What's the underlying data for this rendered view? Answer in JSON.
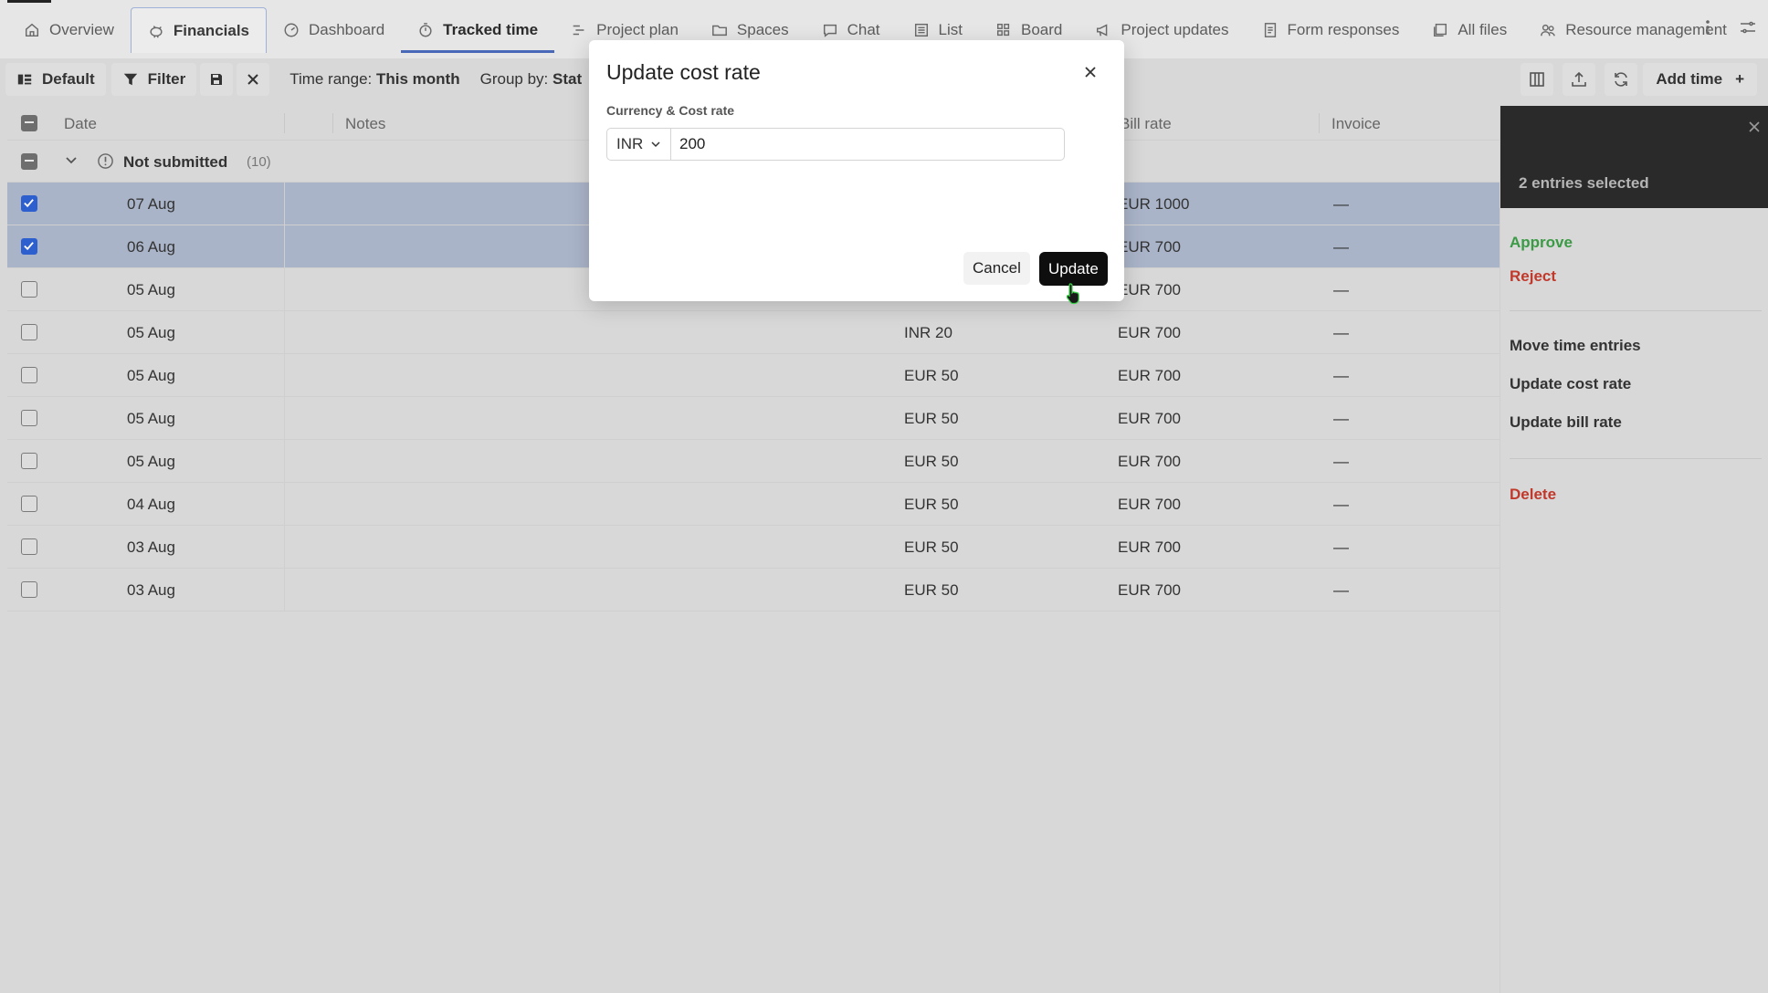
{
  "tabs": [
    {
      "label": "Overview",
      "icon": "home-icon"
    },
    {
      "label": "Financials",
      "icon": "piggy-bank-icon"
    },
    {
      "label": "Dashboard",
      "icon": "gauge-icon"
    },
    {
      "label": "Tracked time",
      "icon": "stopwatch-icon"
    },
    {
      "label": "Project plan",
      "icon": "gantt-icon"
    },
    {
      "label": "Spaces",
      "icon": "folder-icon"
    },
    {
      "label": "Chat",
      "icon": "chat-icon"
    },
    {
      "label": "List",
      "icon": "list-icon"
    },
    {
      "label": "Board",
      "icon": "board-icon"
    },
    {
      "label": "Project updates",
      "icon": "megaphone-icon"
    },
    {
      "label": "Form responses",
      "icon": "form-icon"
    },
    {
      "label": "All files",
      "icon": "files-icon"
    },
    {
      "label": "Resource management",
      "icon": "people-icon"
    }
  ],
  "toolbar": {
    "view_label": "Default",
    "filter_label": "Filter",
    "time_range_label": "Time range:",
    "time_range_value": "This month",
    "group_by_label": "Group by:",
    "group_by_value": "Stat",
    "add_time_label": "Add time"
  },
  "table": {
    "headers": {
      "date": "Date",
      "notes": "Notes",
      "bill_rate": "Bill rate",
      "invoice": "Invoice"
    },
    "group": {
      "label": "Not submitted",
      "count": "(10)"
    },
    "rows": [
      {
        "date": "07 Aug",
        "cost": "",
        "bill": "EUR 1000",
        "invoice": "—",
        "selected": true
      },
      {
        "date": "06 Aug",
        "cost": "",
        "bill": "EUR 700",
        "invoice": "—",
        "selected": true
      },
      {
        "date": "05 Aug",
        "cost": "",
        "bill": "EUR 700",
        "invoice": "—",
        "selected": false
      },
      {
        "date": "05 Aug",
        "cost": "INR 20",
        "bill": "EUR 700",
        "invoice": "—",
        "selected": false
      },
      {
        "date": "05 Aug",
        "cost": "EUR 50",
        "bill": "EUR 700",
        "invoice": "—",
        "selected": false
      },
      {
        "date": "05 Aug",
        "cost": "EUR 50",
        "bill": "EUR 700",
        "invoice": "—",
        "selected": false
      },
      {
        "date": "05 Aug",
        "cost": "EUR 50",
        "bill": "EUR 700",
        "invoice": "—",
        "selected": false
      },
      {
        "date": "04 Aug",
        "cost": "EUR 50",
        "bill": "EUR 700",
        "invoice": "—",
        "selected": false
      },
      {
        "date": "03 Aug",
        "cost": "EUR 50",
        "bill": "EUR 700",
        "invoice": "—",
        "selected": false
      },
      {
        "date": "03 Aug",
        "cost": "EUR 50",
        "bill": "EUR 700",
        "invoice": "—",
        "selected": false
      }
    ]
  },
  "panel": {
    "title": "2 entries selected",
    "approve": "Approve",
    "reject": "Reject",
    "move": "Move time entries",
    "update_cost": "Update cost rate",
    "update_bill": "Update bill rate",
    "delete": "Delete"
  },
  "modal": {
    "title": "Update cost rate",
    "field_label": "Currency & Cost rate",
    "currency": "INR",
    "amount": "200",
    "cancel_label": "Cancel",
    "update_label": "Update"
  },
  "colors": {
    "accent": "#4a68b8",
    "checkbox_blue": "#2e5fcf",
    "approve_green": "#3b9a45",
    "reject_red": "#c0392b"
  }
}
